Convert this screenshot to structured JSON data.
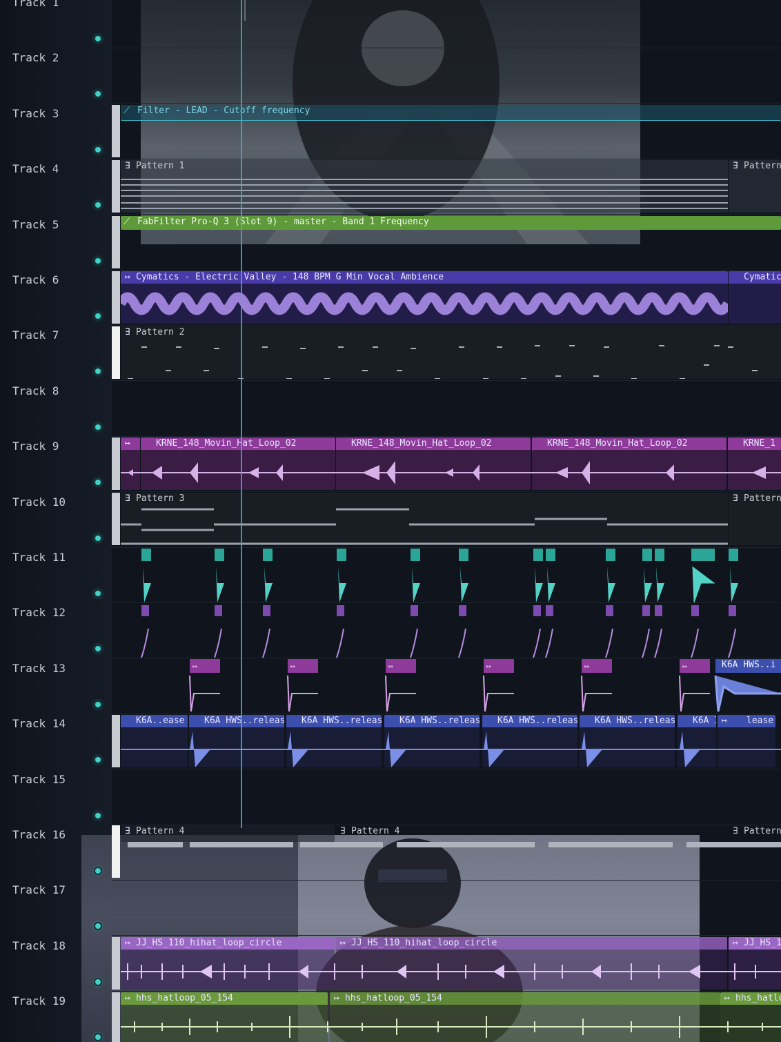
{
  "tracks": [
    {
      "label": "Track 1"
    },
    {
      "label": "Track 2"
    },
    {
      "label": "Track 3"
    },
    {
      "label": "Track 4"
    },
    {
      "label": "Track 5"
    },
    {
      "label": "Track 6"
    },
    {
      "label": "Track 7"
    },
    {
      "label": "Track 8"
    },
    {
      "label": "Track 9"
    },
    {
      "label": "Track 10"
    },
    {
      "label": "Track 11"
    },
    {
      "label": "Track 12"
    },
    {
      "label": "Track 13"
    },
    {
      "label": "Track 14"
    },
    {
      "label": "Track 15"
    },
    {
      "label": "Track 16"
    },
    {
      "label": "Track 17"
    },
    {
      "label": "Track 18"
    },
    {
      "label": "Track 19"
    }
  ],
  "clips": {
    "automation_filter": "Filter - LEAD - Cutoff frequency",
    "pattern1_a": "Pattern 1",
    "pattern1_b": "Pattern",
    "automation_fabfilter": "FabFilter Pro-Q 3 (Slot 9) - master - Band 1 Frequency",
    "cymatics_a": "Cymatics - Electric Valley - 148 BPM G Min Vocal Ambience",
    "cymatics_b": "Cymatic",
    "pattern2": "Pattern 2",
    "krne_1": "KRNE_148_Movin_Hat_Loop_02",
    "krne_2": "KRNE_148_Movin_Hat_Loop_02",
    "krne_3": "KRNE_148_Movin_Hat_Loop_02",
    "krne_4": "KRNE_1",
    "pattern3_a": "Pattern 3",
    "pattern3_b": "Pattern",
    "k6a_13_last": "K6A HWS..i",
    "k6a_14_first": "K6A..ease",
    "k6a_14_mid": "K6A HWS..release",
    "k6a_14_short": "K6A I",
    "k6a_14_tail": "lease",
    "pattern4_a": "Pattern 4",
    "pattern4_b": "Pattern 4",
    "pattern4_c": "Pattern",
    "jj_a": "JJ_HS_110_hihat_loop_circle",
    "jj_b": "JJ_HS_110_hihat_loop_circle",
    "jj_c": "JJ_HS_1",
    "hhs_a": "hhs_hatloop_05_154",
    "hhs_b": "hhs_hatloop_05_154",
    "hhs_c": "hhs_hatlo"
  },
  "colors": {
    "accent": "#3fd2c8",
    "purple_clip": "#4a3aa8",
    "pink_clip": "#8e3a9a",
    "green_clip": "#6a9a3c",
    "teal_clip": "#2aa597",
    "blue_clip": "#3d4fae"
  },
  "icons": {
    "pattern": "pattern-icon",
    "audio": "audio-clip-icon",
    "automation": "automation-icon"
  }
}
